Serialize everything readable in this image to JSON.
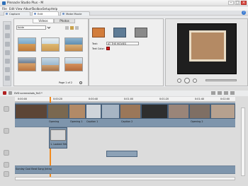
{
  "window": {
    "title": "Pinnacle Studio Plus - M",
    "buttons": [
      "–",
      "□",
      "×"
    ]
  },
  "menu": {
    "items": [
      "File",
      "Edit",
      "View",
      "Album",
      "Toolbox",
      "Setup",
      "Help"
    ]
  },
  "mode_tabs": [
    {
      "label": "Capture",
      "active": false
    },
    {
      "label": "Edit",
      "active": true
    },
    {
      "label": "Make Movie",
      "active": false
    }
  ],
  "help": {
    "label": "?"
  },
  "library": {
    "tabs": [
      "Videos",
      "Photos"
    ],
    "folder_select_value": "foide",
    "page_label": "Page 1 of 2"
  },
  "editor": {
    "text_label": "Text:",
    "text_value": "AT THE MOVIES",
    "text_color_label": "Text Color:"
  },
  "timeline": {
    "project_name": "DVD screenshots_fin3 *",
    "clips": [
      "Opening",
      "Opening 1",
      "Caption 1",
      "Caption 2",
      "Opening 2"
    ],
    "title_clip": "1. Looked 5th",
    "music_clip": "Sunday Cool Beat Song (Intro)",
    "ruler_ticks": [
      "0:00:00",
      "0:00:20",
      "0:00:40",
      "0:01:00",
      "0:01:20",
      "0:01:40",
      "0:02:00"
    ]
  }
}
